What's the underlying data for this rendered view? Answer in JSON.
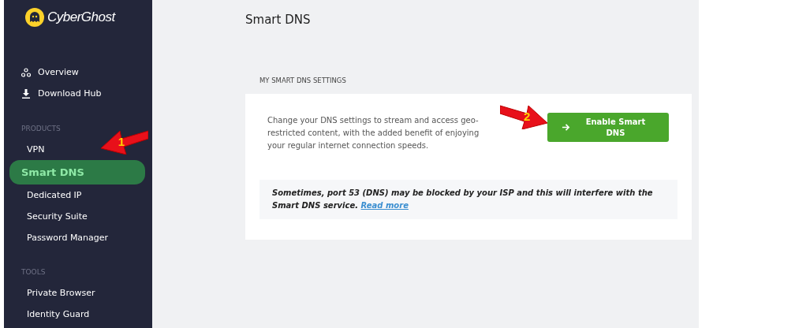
{
  "sidebar": {
    "logo": "CyberGhost",
    "sections": [
      {
        "items": [
          {
            "label": "Overview",
            "selected": false
          },
          {
            "label": "Download Hub",
            "selected": false
          }
        ]
      },
      {
        "heading": "PRODUCTS",
        "items": [
          {
            "label": "VPN",
            "selected": false
          },
          {
            "label": "Smart DNS",
            "selected": true
          },
          {
            "label": "Dedicated IP",
            "selected": false
          },
          {
            "label": "Security Suite",
            "selected": false
          },
          {
            "label": "Password Manager",
            "selected": false
          }
        ]
      },
      {
        "heading": "TOOLS",
        "items": [
          {
            "label": "Private Browser",
            "selected": false
          },
          {
            "label": "Identity Guard",
            "selected": false
          }
        ]
      }
    ]
  },
  "page": {
    "title": "Smart DNS",
    "section_label": "MY SMART DNS SETTINGS",
    "description": "Change your DNS settings to stream and access geo-restricted content, with the added benefit of enjoying your regular internet connection speeds.",
    "button": "Enable Smart DNS",
    "note": "Sometimes, port 53 (DNS) may be blocked by your ISP and this will interfere with the Smart DNS service.",
    "note_link": "Read more"
  },
  "annotations": [
    {
      "number": "1"
    },
    {
      "number": "2"
    }
  ]
}
